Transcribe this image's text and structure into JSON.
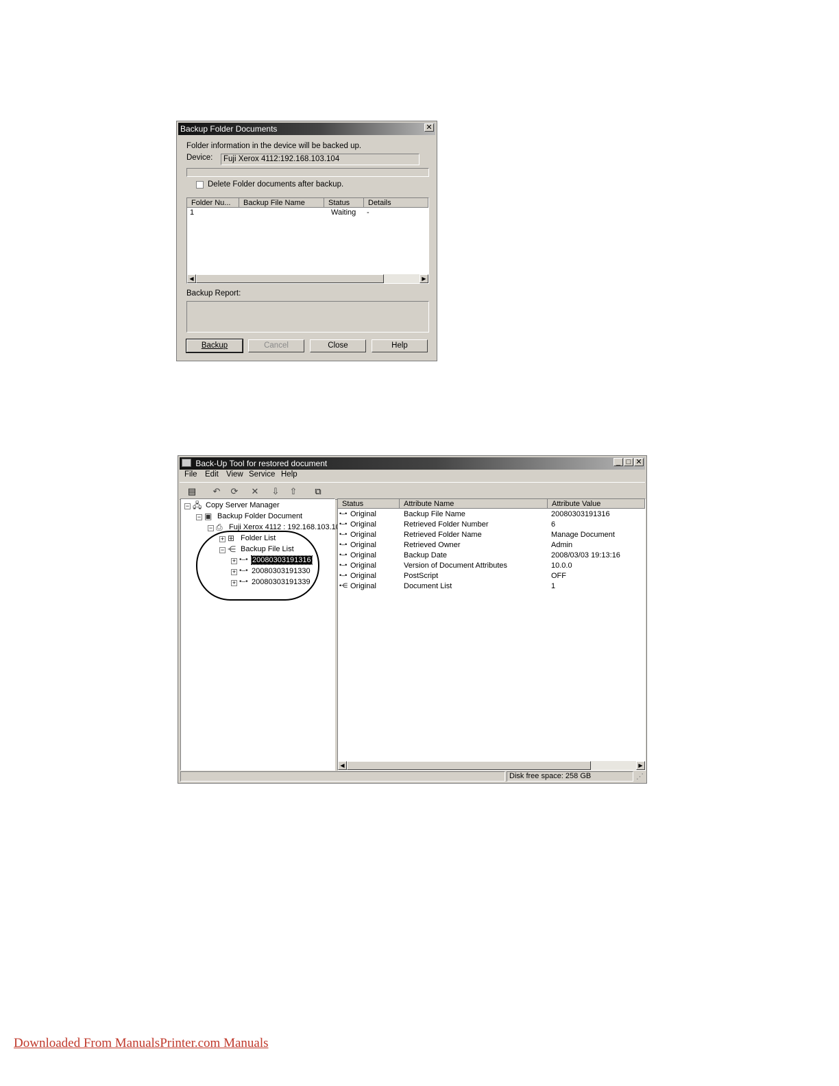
{
  "dialog": {
    "title": "Backup Folder  Documents",
    "close_glyph": "✕",
    "info_text": "Folder information in the device will be backed up.",
    "device_label": "Device:",
    "device_value": "Fuji Xerox 4112:192.168.103.104",
    "delete_checkbox_label": "Delete Folder  documents after backup.",
    "delete_checked": false,
    "columns": [
      "Folder Nu...",
      "Backup File Name",
      "Status",
      "Details"
    ],
    "rows": [
      {
        "folder": "1",
        "file": "",
        "status": "Waiting",
        "details": "-"
      }
    ],
    "report_label": "Backup Report:",
    "buttons": {
      "backup": "Backup",
      "cancel": "Cancel",
      "close": "Close",
      "help": "Help"
    }
  },
  "tool": {
    "title": "Back-Up Tool for restored document",
    "menu": [
      "File",
      "Edit",
      "View",
      "Service",
      "Help"
    ],
    "tree": {
      "root": "Copy Server Manager",
      "backup_folder": "Backup Folder  Document",
      "device": "Fuji Xerox 4112 : 192.168.103.104",
      "folder_list": "Folder List",
      "backup_file_list": "Backup File List",
      "files": [
        "20080303191316",
        "20080303191330",
        "20080303191339"
      ],
      "selected_file": "20080303191316"
    },
    "columns": [
      "Status",
      "Attribute Name",
      "Attribute Value"
    ],
    "rows": [
      {
        "status": "Original",
        "name": "Backup File Name",
        "value": "20080303191316"
      },
      {
        "status": "Original",
        "name": "Retrieved Folder Number",
        "value": "6"
      },
      {
        "status": "Original",
        "name": "Retrieved Folder Name",
        "value": "Manage Document"
      },
      {
        "status": "Original",
        "name": "Retrieved Owner",
        "value": "Admin"
      },
      {
        "status": "Original",
        "name": "Backup Date",
        "value": "2008/03/03 19:13:16"
      },
      {
        "status": "Original",
        "name": "Version of Document Attributes",
        "value": "10.0.0"
      },
      {
        "status": "Original",
        "name": "PostScript",
        "value": "OFF"
      },
      {
        "status": "Original",
        "name": "Document List",
        "value": "1"
      }
    ],
    "status_bar": "Disk free space: 258 GB"
  },
  "footer": {
    "link_text": "Downloaded From ManualsPrinter.com Manuals"
  }
}
